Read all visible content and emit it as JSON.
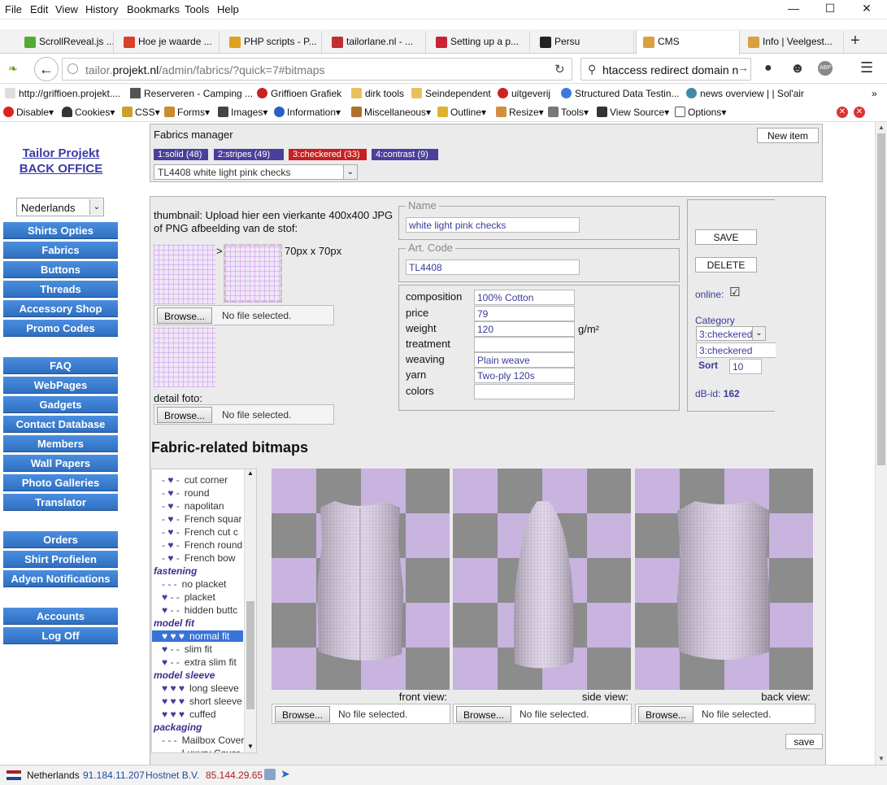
{
  "browser": {
    "menu": [
      "File",
      "Edit",
      "View",
      "History",
      "Bookmarks",
      "Tools",
      "Help"
    ],
    "tabs": [
      {
        "label": "ScrollReveal.js ...",
        "color": "#55aa33"
      },
      {
        "label": "Hoe je waarde ...",
        "color": "#d8402a"
      },
      {
        "label": "PHP scripts - P...",
        "color": "#e0a020"
      },
      {
        "label": "tailorlane.nl - ...",
        "color": "#c03030"
      },
      {
        "label": "Setting up a p...",
        "color": "#cc2233"
      },
      {
        "label": "Persu",
        "color": "#222222"
      },
      {
        "label": "CMS",
        "color": "#d8a040"
      },
      {
        "label": "Info | Veelgest...",
        "color": "#d8a040"
      }
    ],
    "url_gray": "tailor.",
    "url_domain": "projekt.nl",
    "url_path": "/admin/fabrics/?quick=7#bitmaps",
    "search": "htaccess redirect domain n",
    "bookmarks": [
      "http://griffioen.projekt....",
      "Reserveren - Camping ...",
      "Griffioen Grafiek",
      "dirk tools",
      "Seindependent",
      "uitgeverij",
      "Structured Data Testin...",
      "news overview | | Sol'air"
    ],
    "devtools": [
      "Disable▾",
      "Cookies▾",
      "CSS▾",
      "Forms▾",
      "Images▾",
      "Information▾",
      "Miscellaneous▾",
      "Outline▾",
      "Resize▾",
      "Tools▾",
      "View Source▾",
      "Options▾"
    ]
  },
  "sidebar": {
    "brand1": "Tailor Projekt",
    "brand2": "BACK OFFICE",
    "language": "Nederlands",
    "group1": [
      "Shirts Opties",
      "Fabrics",
      "Buttons",
      "Threads",
      "Accessory Shop",
      "Promo Codes"
    ],
    "group2": [
      "FAQ",
      "WebPages",
      "Gadgets",
      "Contact Database",
      "Members",
      "Wall Papers",
      "Photo Galleries",
      "Translator"
    ],
    "group3": [
      "Orders",
      "Shirt Profielen",
      "Adyen Notifications"
    ],
    "group4": [
      "Accounts",
      "Log Off"
    ]
  },
  "manager": {
    "title": "Fabrics manager",
    "new_item": "New item",
    "filters": [
      {
        "label": "1:solid (48)",
        "color": "#4a3f9a"
      },
      {
        "label": "2:stripes (49)",
        "color": "#4a3f9a"
      },
      {
        "label": "3:checkered (33)",
        "color": "#c62020"
      },
      {
        "label": "4:contrast (9)",
        "color": "#4a3f9a"
      }
    ],
    "selected_fabric": "TL4408 white light pink checks"
  },
  "form": {
    "thumb_text": "thumbnail: Upload hier een vierkante 400x400 JPG of PNG afbeelding van de stof:",
    "arrow": ">",
    "size_text": "70px x 70px",
    "browse": "Browse...",
    "no_file": "No file selected.",
    "detail_label": "detail foto:",
    "name_legend": "Name",
    "name_value": "white light pink checks",
    "art_legend": "Art. Code",
    "art_value": "TL4408",
    "specs": [
      {
        "label": "composition",
        "value": "100% Cotton"
      },
      {
        "label": "price",
        "value": "79"
      },
      {
        "label": "weight",
        "value": "120"
      },
      {
        "label": "treatment",
        "value": ""
      },
      {
        "label": "weaving",
        "value": "Plain weave"
      },
      {
        "label": "yarn",
        "value": "Two-ply 120s"
      },
      {
        "label": "colors",
        "value": ""
      }
    ],
    "weight_unit": "g/m²",
    "save": "SAVE",
    "delete": "DELETE",
    "online_label": "online:",
    "online_check": "☑",
    "category_label": "Category",
    "category_select": "3:checkered",
    "category_value": "3:checkered",
    "sort_label": "Sort",
    "sort_value": "10",
    "dbid_label": "dB-id:",
    "dbid_value": "162"
  },
  "bitmaps": {
    "heading": "Fabric-related bitmaps",
    "tree": [
      {
        "t": "item",
        "h": "- ♥ -",
        "l": "cut corner"
      },
      {
        "t": "item",
        "h": "- ♥ -",
        "l": "round"
      },
      {
        "t": "item",
        "h": "- ♥ -",
        "l": "napolitan"
      },
      {
        "t": "item",
        "h": "- ♥ -",
        "l": "French squar"
      },
      {
        "t": "item",
        "h": "- ♥ -",
        "l": "French cut c"
      },
      {
        "t": "item",
        "h": "- ♥ -",
        "l": "French round"
      },
      {
        "t": "item",
        "h": "- ♥ -",
        "l": "French bow"
      },
      {
        "t": "sec",
        "l": "fastening"
      },
      {
        "t": "item",
        "h": "- - -",
        "l": "no placket"
      },
      {
        "t": "item",
        "h": "♥ - -",
        "l": "placket"
      },
      {
        "t": "item",
        "h": "♥ - -",
        "l": "hidden buttc"
      },
      {
        "t": "sec",
        "l": "model fit"
      },
      {
        "t": "sel",
        "h": "♥ ♥ ♥",
        "l": "normal fit"
      },
      {
        "t": "item",
        "h": "♥ - -",
        "l": "slim fit"
      },
      {
        "t": "item",
        "h": "♥ - -",
        "l": "extra slim fit"
      },
      {
        "t": "sec",
        "l": "model sleeve"
      },
      {
        "t": "item",
        "h": "♥ ♥ ♥",
        "l": "long sleeve"
      },
      {
        "t": "item",
        "h": "♥ ♥ ♥",
        "l": "short sleeve"
      },
      {
        "t": "item",
        "h": "♥ ♥ ♥",
        "l": "cuffed"
      },
      {
        "t": "sec",
        "l": "packaging"
      },
      {
        "t": "item",
        "h": "- - -",
        "l": "Mailbox Cover"
      },
      {
        "t": "item",
        "h": "- - -",
        "l": "Luxury Cover"
      }
    ],
    "views": [
      "front view:",
      "side view:",
      "back view:"
    ],
    "save_label": "save"
  },
  "status": {
    "country": "Netherlands",
    "ip1": "91.184.11.207",
    "isp": "Hostnet B.V.",
    "ip2": "85.144.29.65"
  }
}
